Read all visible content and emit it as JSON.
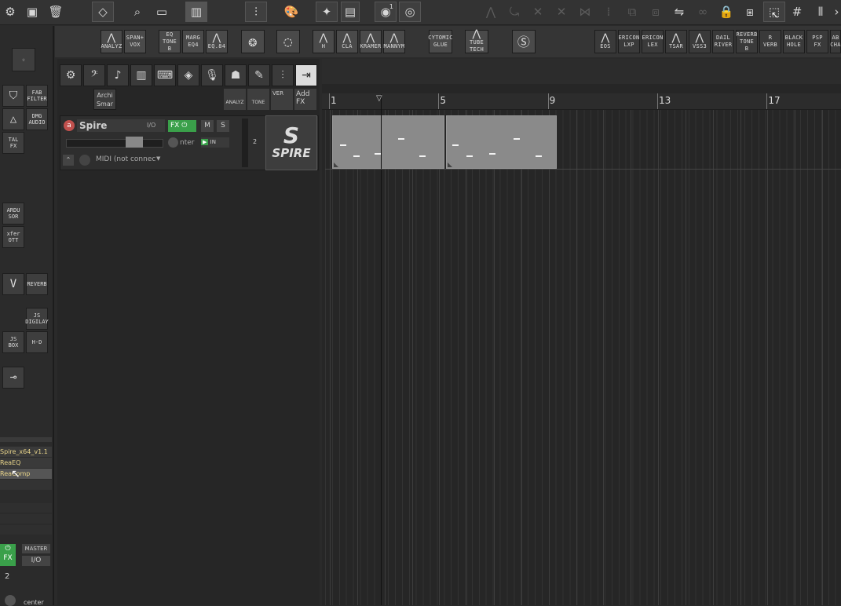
{
  "toolbar": {
    "icons": [
      "gear-icon",
      "save-icon",
      "trash-icon",
      "eraser-icon",
      "search-icon",
      "crop-icon",
      "spectrum-icon",
      "mixer-icon",
      "palette-icon",
      "lantern-icon",
      "monitor-icon",
      "record-count-icon",
      "disc-icon"
    ],
    "record_count": "1"
  },
  "fx_bar": {
    "left_group": [
      {
        "top": "",
        "bottom": "ANALYZ"
      },
      {
        "top": "SPAN+",
        "bottom": "VOX"
      },
      {
        "top": "EQ",
        "bottom": "TONE B"
      },
      {
        "top": "MARG",
        "bottom": "EQ4"
      },
      {
        "top": "",
        "bottom": "EQ.84"
      }
    ],
    "mid_group": [
      {
        "top": "",
        "bottom": "H"
      },
      {
        "top": "",
        "bottom": "CLA"
      },
      {
        "top": "",
        "bottom": "KRAMER"
      },
      {
        "top": "",
        "bottom": "MANNYM"
      },
      {
        "top": "CYTOMIC",
        "bottom": "GLUE"
      },
      {
        "top": "",
        "bottom": "TUBE TECH"
      }
    ],
    "right_group": [
      {
        "top": "",
        "bottom": "EOS"
      },
      {
        "top": "ERICON",
        "bottom": "LXP"
      },
      {
        "top": "ERICON",
        "bottom": "LEX"
      },
      {
        "top": "",
        "bottom": "TSAR"
      },
      {
        "top": "",
        "bottom": "VSS3"
      },
      {
        "top": "DAIL",
        "bottom": "RIVER"
      },
      {
        "top": "REVERB",
        "bottom": "TONE B"
      },
      {
        "top": "R VERB",
        "bottom": ""
      },
      {
        "top": "BLACK",
        "bottom": "HOLE"
      },
      {
        "top": "PSP",
        "bottom": "FX"
      },
      {
        "top": "AB",
        "bottom": "CHA"
      }
    ]
  },
  "left_panel": {
    "buttons": [
      {
        "top": "FAB",
        "bottom": "FILTER"
      },
      {
        "top": "DMG",
        "bottom": "AUDIO"
      },
      {
        "top": "TAL",
        "bottom": "FX"
      },
      {
        "top": "ARDU",
        "bottom": "SOR"
      },
      {
        "top": "xfer",
        "bottom": "OTT"
      },
      {
        "top": "",
        "bottom": "REVERB"
      },
      {
        "top": "JS",
        "bottom": "DIGILAY"
      },
      {
        "top": "JS",
        "bottom": "BOX"
      },
      {
        "top": "",
        "bottom": "H-D"
      }
    ],
    "fx_chain": [
      "Spire_x64_v1.1",
      "ReaEQ",
      "ReaComp"
    ],
    "master_label": "MASTER",
    "io_label": "I/O",
    "fx_label": "FX",
    "track_count": "2",
    "pan_label": "center"
  },
  "track_tools": {
    "archi_label_1": "Archi",
    "archi_label_2": "Smar",
    "analyz_label": "ANALYZ",
    "tone_label": "TONE",
    "ver_label": "VER",
    "addfx_label_1": "Add",
    "addfx_label_2": "FX"
  },
  "track": {
    "name": "Spire",
    "io_button": "I/O",
    "fx_button": "FX",
    "mute": "M",
    "solo": "S",
    "pan_text": "nter",
    "input_label": "IN",
    "midi_input": "MIDI (not connec",
    "number": "2",
    "plugin_logo": "SPIRE"
  },
  "ruler": {
    "marks": [
      {
        "label": "1",
        "bar": 1
      },
      {
        "label": "5",
        "bar": 5
      },
      {
        "label": "9",
        "bar": 9
      },
      {
        "label": "13",
        "bar": 13
      },
      {
        "label": "17",
        "bar": 17
      }
    ]
  },
  "midi_items": [
    {
      "start_bar": 1.1,
      "end_bar": 5.2,
      "notes": [
        {
          "pos": 0.06,
          "pitch": 0.6
        },
        {
          "pos": 0.18,
          "pitch": 0.85
        },
        {
          "pos": 0.37,
          "pitch": 0.8
        },
        {
          "pos": 0.58,
          "pitch": 0.45
        },
        {
          "pos": 0.77,
          "pitch": 0.85
        }
      ]
    },
    {
      "start_bar": 5.25,
      "end_bar": 9.3,
      "notes": [
        {
          "pos": 0.05,
          "pitch": 0.6
        },
        {
          "pos": 0.18,
          "pitch": 0.85
        },
        {
          "pos": 0.38,
          "pitch": 0.8
        },
        {
          "pos": 0.6,
          "pitch": 0.45
        },
        {
          "pos": 0.8,
          "pitch": 0.85
        }
      ]
    }
  ],
  "colors": {
    "item": "#8a8a8a",
    "note": "#f2f2f2",
    "green": "#3aa04a",
    "fx_text": "#e8d48a"
  }
}
